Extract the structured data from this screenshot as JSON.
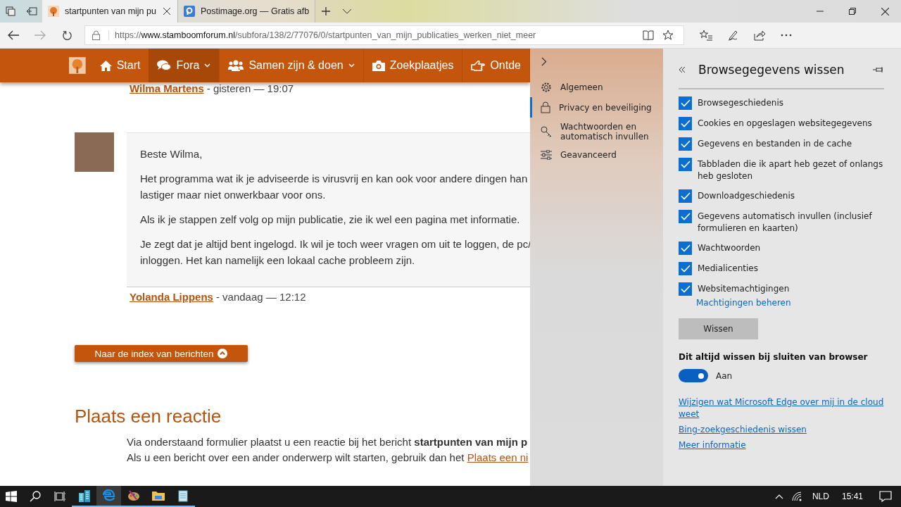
{
  "browser": {
    "tabs": [
      {
        "title": "startpunten van mijn pu",
        "selected": true,
        "kind": "site"
      },
      {
        "title": "Postimage.org — Gratis afb",
        "selected": false,
        "kind": "p"
      }
    ],
    "address": {
      "scheme": "https://",
      "host": "www.stamboomforum.nl",
      "path": "/subfora/138/2/77076/0/startpunten_van_mijn_publicaties_werken_niet_meer"
    }
  },
  "site_nav": [
    {
      "label": "Start",
      "kind": "home",
      "selected": false,
      "caret": false
    },
    {
      "label": "Fora",
      "kind": "comments",
      "selected": true,
      "caret": true
    },
    {
      "label": "Samen zijn & doen",
      "kind": "users",
      "selected": false,
      "caret": true
    },
    {
      "label": "Zoekplaatjes",
      "kind": "camera",
      "selected": false,
      "caret": false
    },
    {
      "label": "Ontde",
      "kind": "hand",
      "selected": false,
      "caret": false
    }
  ],
  "previous_post": {
    "author": "Wilma Martens",
    "meta": "- gisteren — 19:07"
  },
  "post": {
    "paragraphs": [
      [
        "Beste Wilma,"
      ],
      [
        "Het programma wat ik je adviseerde is virusvrij en kan ook voor andere dingen han",
        "lastiger maar niet onwerkbaar voor ons."
      ],
      [
        "Als ik je stappen zelf volg op mijn publicatie, zie ik wel een pagina met informatie."
      ],
      [
        "Je zegt dat je altijd bent ingelogd. Ik wil je toch weer vragen om uit te loggen, de pc/",
        "inloggen. Het kan namelijk een lokaal cache probleem zijn."
      ]
    ],
    "author": "Yolanda Lippens",
    "meta": "- vandaag — 12:12"
  },
  "index_button": "Naar de index van berichten",
  "reply": {
    "heading": "Plaats een reactie",
    "line_1": "Via onderstaand formulier plaatst u een reactie bij het bericht **startpunten van mijn p**",
    "line_2": "Als u een bericht over een ander onderwerp wilt starten, gebruik dan het ",
    "line_2_link": "Plaats een ni"
  },
  "settings_nav": [
    {
      "label": "Algemeen",
      "kind": "gear",
      "selected": false
    },
    {
      "label": "Privacy en beveiliging",
      "kind": "lock",
      "selected": true
    },
    {
      "label": "Wachtwoorden en automatisch invullen",
      "kind": "key",
      "selected": false
    },
    {
      "label": "Geavanceerd",
      "kind": "sliders",
      "selected": false
    }
  ],
  "panel": {
    "title": "Browsegegevens wissen",
    "options": [
      {
        "label": "Browsegeschiedenis",
        "checked": true
      },
      {
        "label": "Cookies en opgeslagen websitegegevens",
        "checked": true
      },
      {
        "label": "Gegevens en bestanden in de cache",
        "checked": true
      },
      {
        "label": "Tabbladen die ik apart heb gezet of onlangs heb gesloten",
        "checked": true
      },
      {
        "label": "Downloadgeschiedenis",
        "checked": true
      },
      {
        "label": "Gegevens automatisch invullen (inclusief formulieren en kaarten)",
        "checked": true
      },
      {
        "label": "Wachtwoorden",
        "checked": true
      },
      {
        "label": "Medialicenties",
        "checked": true
      },
      {
        "label": "Websitemachtigingen",
        "checked": true
      }
    ],
    "permissions_link": "Machtigingen beheren",
    "clear_button": "Wissen",
    "toggle": {
      "label": "Dit altijd wissen bij sluiten van browser",
      "on": true,
      "state_text": "Aan"
    },
    "links": [
      "Wijzigen wat Microsoft Edge over mij in de cloud weet",
      "Bing-zoekgeschiedenis wissen",
      "Meer informatie"
    ]
  },
  "taskbar": {
    "apps": [
      {
        "kind": "buildings",
        "selected": false
      },
      {
        "kind": "edge",
        "selected": true
      },
      {
        "kind": "palette",
        "selected": false
      },
      {
        "kind": "folder",
        "selected": false
      },
      {
        "kind": "notepad",
        "selected": false
      }
    ],
    "language": "NLD",
    "time": "15:41"
  }
}
